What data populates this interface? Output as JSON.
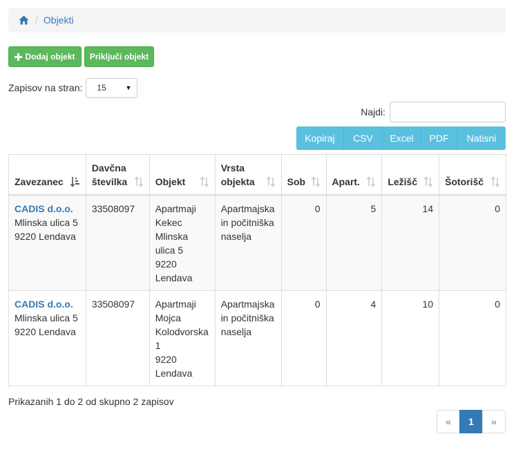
{
  "breadcrumb": {
    "home_icon": "home-icon",
    "separator": "/",
    "current": "Objekti"
  },
  "toolbar": {
    "add_label": "Dodaj objekt",
    "add_icon": "plus-icon",
    "attach_label": "Priključi objekt"
  },
  "page_size": {
    "label": "Zapisov na stran:",
    "value": "15"
  },
  "search": {
    "label": "Najdi:",
    "value": ""
  },
  "exports": [
    "Kopiraj",
    "CSV",
    "Excel",
    "PDF",
    "Natisni"
  ],
  "table": {
    "columns": [
      {
        "label": "Zavezanec",
        "sort": "sort-desc-active-icon"
      },
      {
        "label": "Davčna številka",
        "sort": "sort-icon"
      },
      {
        "label": "Objekt",
        "sort": "sort-icon"
      },
      {
        "label": "Vrsta objekta",
        "sort": "sort-icon"
      },
      {
        "label": "Sob",
        "sort": "sort-icon"
      },
      {
        "label": "Apart.",
        "sort": "sort-icon"
      },
      {
        "label": "Ležišč",
        "sort": "sort-icon"
      },
      {
        "label": "Šotorišč",
        "sort": "sort-icon"
      }
    ],
    "rows": [
      {
        "zavezanec_name": "CADIS d.o.o.",
        "zavezanec_street": "Mlinska ulica 5",
        "zavezanec_city": "9220 Lendava",
        "davcna": "33508097",
        "objekt": [
          "Apartmaji",
          "Kekec",
          "Mlinska",
          "ulica 5",
          "9220",
          "Lendava"
        ],
        "vrsta": [
          "Apartmajska",
          "in počitniška",
          "naselja"
        ],
        "sob": "0",
        "apart": "5",
        "lezisc": "14",
        "sotorisc": "0"
      },
      {
        "zavezanec_name": "CADIS d.o.o.",
        "zavezanec_street": "Mlinska ulica 5",
        "zavezanec_city": "9220 Lendava",
        "davcna": "33508097",
        "objekt": [
          "Apartmaji",
          "Mojca",
          "Kolodvorska",
          "1",
          "9220",
          "Lendava"
        ],
        "vrsta": [
          "Apartmajska",
          "in počitniška",
          "naselja"
        ],
        "sob": "0",
        "apart": "4",
        "lezisc": "10",
        "sotorisc": "0"
      }
    ]
  },
  "footer": {
    "info": "Prikazanih 1 do 2 od skupno 2 zapisov",
    "pager": {
      "prev": "«",
      "current": "1",
      "next": "»"
    }
  },
  "colors": {
    "primary": "#337ab7",
    "success": "#5cb85c",
    "info": "#5bc0de"
  }
}
